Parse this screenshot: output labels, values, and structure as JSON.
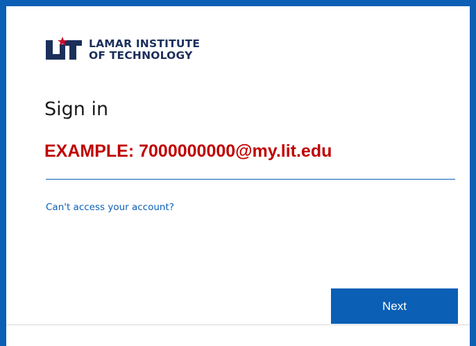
{
  "brand": {
    "logo_mark": "LIT",
    "line1": "LAMAR INSTITUTE",
    "line2": "OF TECHNOLOGY",
    "colors": {
      "navy": "#1b2f5b",
      "red": "#c8102e",
      "accent_blue": "#0b5fb5"
    }
  },
  "signin": {
    "title": "Sign in",
    "example_hint": "EXAMPLE: 7000000000@my.lit.edu",
    "email_value": "",
    "help_link": "Can't access your account?",
    "next_label": "Next"
  }
}
